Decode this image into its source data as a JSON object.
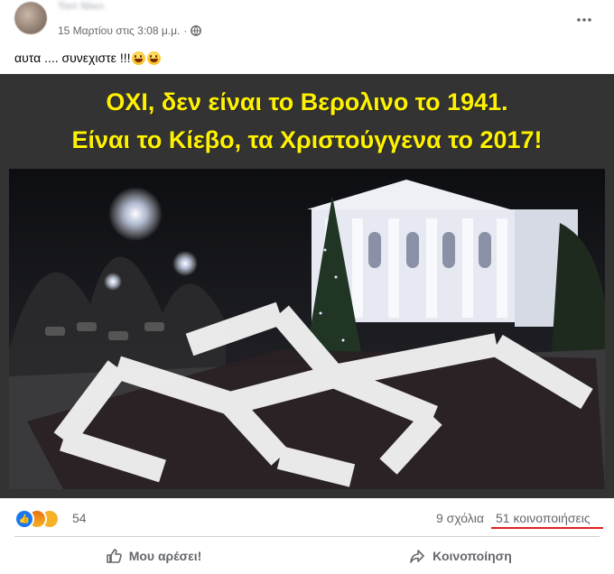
{
  "post": {
    "author": "Τασ Νίκο",
    "timestamp": "15 Μαρτίου στις 3:08 μ.μ.",
    "audience_icon": "globe-icon",
    "caption": "αυτα .... συνεχιστε !!!",
    "caption_emojis": [
      "grinning-face",
      "grinning-face"
    ]
  },
  "image": {
    "headline_line1": "ΟΧΙ, δεν είναι το Βερολινο το 1941.",
    "headline_line2": "Είναι το Κίεβο, τα Χριστούγγενα το 2017!",
    "headline_color": "#fff200"
  },
  "stats": {
    "reaction_icons": [
      "like-icon",
      "angry-icon",
      "wow-icon"
    ],
    "reaction_count": "54",
    "comments": "9 σχόλια",
    "shares": "51 κοινοποιήσεις",
    "shares_underline_color": "#e02020"
  },
  "actions": {
    "like_label": "Μου αρέσει!",
    "share_label": "Κοινοποίηση"
  }
}
